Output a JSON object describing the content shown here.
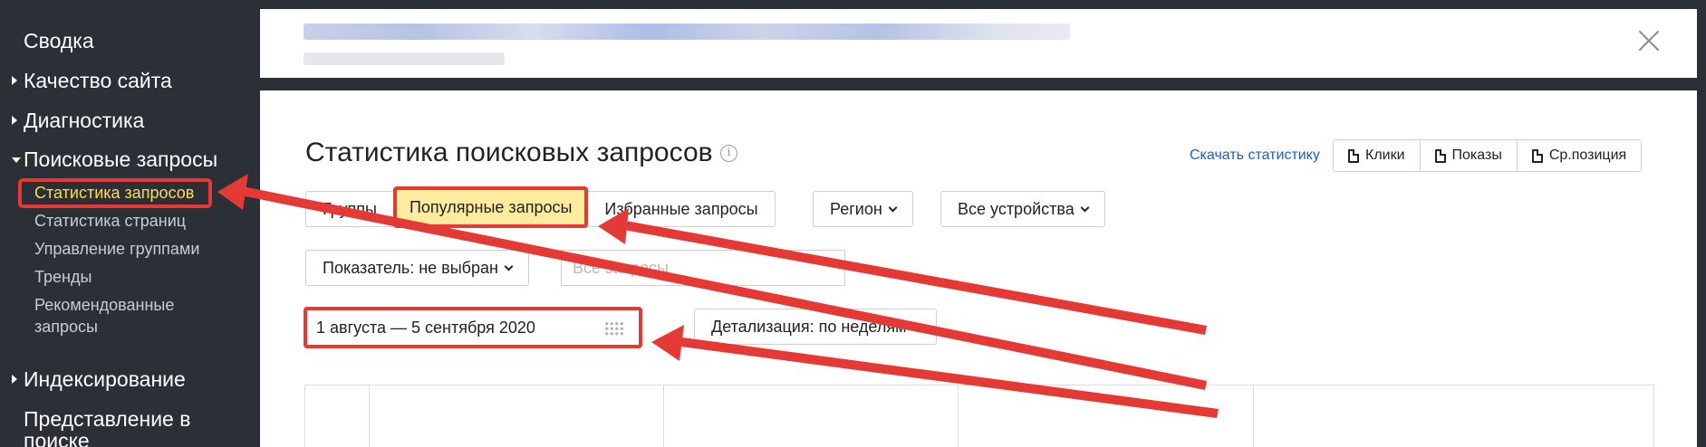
{
  "sidebar": {
    "items": [
      {
        "label": "Сводка"
      },
      {
        "label": "Качество сайта"
      },
      {
        "label": "Диагностика"
      },
      {
        "label": "Поисковые запросы"
      },
      {
        "label": "Индексирование"
      },
      {
        "label": "Представление в поиске"
      }
    ],
    "subitems": [
      {
        "label": "Статистика запросов"
      },
      {
        "label": "Статистика страниц"
      },
      {
        "label": "Управление группами"
      },
      {
        "label": "Тренды"
      },
      {
        "label": "Рекомендованные запросы"
      }
    ]
  },
  "main": {
    "title": "Статистика поисковых запросов",
    "info_icon": "i",
    "download_label": "Скачать статистику",
    "metrics": [
      {
        "label": "Клики"
      },
      {
        "label": "Показы"
      },
      {
        "label": "Ср.позиция"
      }
    ],
    "tabs": [
      {
        "label": "Группы"
      },
      {
        "label": "Популярные запросы"
      },
      {
        "label": "Избранные запросы"
      }
    ],
    "region_label": "Регион",
    "devices_label": "Все устройства",
    "indicator_label": "Показатель: не выбран",
    "search_placeholder": "Все запросы",
    "date_range": "1 августа — 5 сентября 2020",
    "detail_label": "Детализация: по неделям"
  },
  "icons": {
    "close": "close-icon",
    "info": "info-icon",
    "document": "document-icon",
    "calendar": "calendar-icon",
    "chevron": "chevron-down-icon",
    "triangle": "triangle-right-icon"
  },
  "colors": {
    "sidebar_bg": "#2b2f36",
    "accent_yellow": "#ffdb4d",
    "active_tab_bg": "#ffeba0",
    "annotation_red": "#e53935",
    "link_blue": "#1a5fc9"
  }
}
